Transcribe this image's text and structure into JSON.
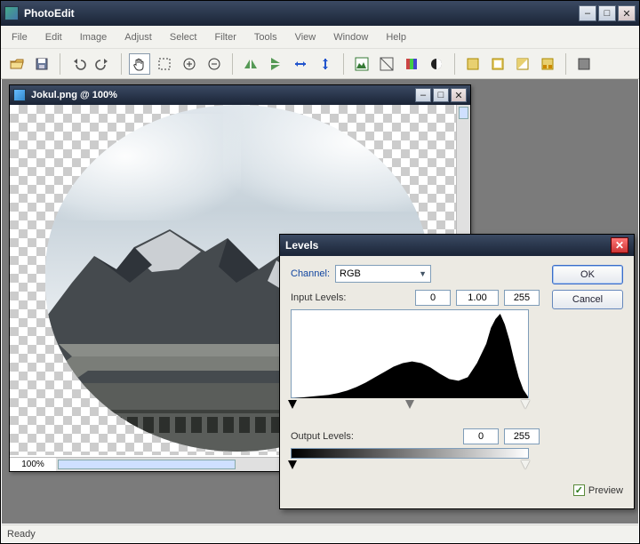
{
  "app": {
    "title": "PhotoEdit",
    "status": "Ready"
  },
  "menus": [
    "File",
    "Edit",
    "Image",
    "Adjust",
    "Select",
    "Filter",
    "Tools",
    "View",
    "Window",
    "Help"
  ],
  "toolbar_icons": [
    "open",
    "save",
    "undo",
    "redo",
    "hand",
    "marquee",
    "zoom-in",
    "zoom-out",
    "flip-h",
    "flip-v",
    "resize-h",
    "resize-v",
    "image-levels",
    "brightness",
    "hue",
    "grayscale",
    "rotate-l",
    "rotate-r",
    "rotate-180",
    "canvas",
    "crop"
  ],
  "document": {
    "title": "Jokul.png @ 100%",
    "zoom": "100%"
  },
  "levels": {
    "title": "Levels",
    "channel_label": "Channel:",
    "channel_value": "RGB",
    "input_label": "Input Levels:",
    "input_black": "0",
    "input_gamma": "1.00",
    "input_white": "255",
    "output_label": "Output Levels:",
    "output_black": "0",
    "output_white": "255",
    "ok": "OK",
    "cancel": "Cancel",
    "preview": "Preview",
    "preview_checked": true
  },
  "chart_data": {
    "type": "area",
    "title": "",
    "xlabel": "",
    "ylabel": "",
    "xlim": [
      0,
      255
    ],
    "ylim": [
      0,
      100
    ],
    "x": [
      0,
      10,
      20,
      30,
      40,
      50,
      60,
      70,
      80,
      90,
      100,
      110,
      120,
      130,
      140,
      150,
      160,
      170,
      180,
      190,
      200,
      210,
      215,
      220,
      225,
      230,
      235,
      240,
      245,
      250,
      255
    ],
    "values": [
      0,
      1,
      2,
      3,
      4,
      6,
      9,
      13,
      18,
      24,
      30,
      36,
      40,
      42,
      40,
      35,
      28,
      22,
      20,
      24,
      40,
      62,
      80,
      90,
      96,
      84,
      66,
      44,
      24,
      10,
      2
    ]
  }
}
